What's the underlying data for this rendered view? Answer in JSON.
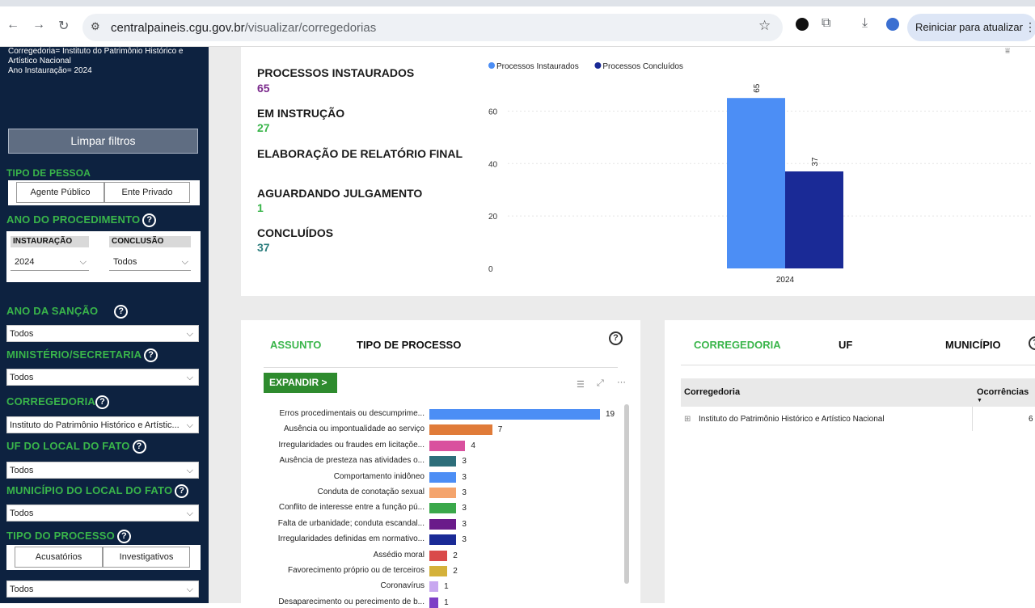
{
  "browser": {
    "url_host": "centralpaineis.cgu.gov.br",
    "url_path": "/visualizar/corregedorias",
    "update_label": "Reiniciar para atualizar"
  },
  "sidebar": {
    "filter_line1": "Corregedoria= Instituto do Patrimônio Histórico e",
    "filter_line2": "Artístico Nacional",
    "filter_line3": "Ano Instauração= 2024",
    "clear_label": "Limpar filtros",
    "tipo_pessoa_title": "TIPO DE PESSOA",
    "agente_publico": "Agente Público",
    "ente_privado": "Ente Privado",
    "ano_proc_title": "ANO DO PROCEDIMENTO",
    "instauracao_label": "INSTAURAÇÃO",
    "conclusao_label": "CONCLUSÃO",
    "instauracao_value": "2024",
    "conclusao_value": "Todos",
    "ano_sancao_title": "ANO DA SANÇÃO",
    "ano_sancao_value": "Todos",
    "ministerio_title": "MINISTÉRIO/SECRETARIA",
    "ministerio_value": "Todos",
    "corregedoria_title": "CORREGEDORIA",
    "corregedoria_value": "Instituto do Patrimônio Histórico e Artístic...",
    "uf_title": "UF DO LOCAL DO FATO",
    "uf_value": "Todos",
    "municipio_title": "MUNICÍPIO DO LOCAL DO FATO",
    "municipio_value": "Todos",
    "tipo_processo_title": "TIPO DO PROCESSO",
    "acusatorios": "Acusatórios",
    "investigativos": "Investigativos",
    "tipo_processo_value": "Todos",
    "help_glyph": "?"
  },
  "kpis": {
    "instaurados_label": "PROCESSOS INSTAURADOS",
    "instaurados_value": "65",
    "instrucao_label": "EM INSTRUÇÃO",
    "instrucao_value": "27",
    "relatorio_label": "ELABORAÇÃO DE RELATÓRIO FINAL",
    "julgamento_label": "AGUARDANDO JULGAMENTO",
    "julgamento_value": "1",
    "concluidos_label": "CONCLUÍDOS",
    "concluidos_value": "37"
  },
  "assunto_panel": {
    "tab_assunto": "ASSUNTO",
    "tab_tipo": "TIPO DE PROCESSO",
    "expandir_label": "EXPANDIR >"
  },
  "corregedoria_panel": {
    "tab_corregedoria": "CORREGEDORIA",
    "tab_uf": "UF",
    "tab_municipio": "MUNICÍPIO",
    "col_corregedoria": "Corregedoria",
    "col_ocorrencias": "Ocorrências",
    "row_name": "Instituto do Patrimônio Histórico e Artístico Nacional",
    "row_value": "6",
    "expand_glyph": "⊞"
  },
  "colors": {
    "green": "#39b54a",
    "purple": "#7b2a8c",
    "teal": "#2b7d7d",
    "light_blue": "#4c8ef5",
    "dark_blue": "#1a2a96"
  },
  "chart_data": [
    {
      "type": "bar",
      "categories": [
        "2024"
      ],
      "series": [
        {
          "name": "Processos Instaurados",
          "values": [
            65
          ],
          "color": "#4c8ef5"
        },
        {
          "name": "Processos Concluídos",
          "values": [
            37
          ],
          "color": "#1a2a96"
        }
      ],
      "yticks": [
        0,
        20,
        40,
        60
      ],
      "ylim": [
        0,
        70
      ],
      "legend": "top-left"
    },
    {
      "type": "bar",
      "orientation": "horizontal",
      "categories": [
        "Erros procedimentais ou descumprime...",
        "Ausência ou impontualidade ao serviço",
        "Irregularidades ou fraudes em licitaçõe...",
        "Ausência de presteza nas atividades o...",
        "Comportamento inidôneo",
        "Conduta de conotação sexual",
        "Conflito de interesse entre a função pú...",
        "Falta de urbanidade; conduta escandal...",
        "Irregularidades definidas em normativo...",
        "Assédio moral",
        "Favorecimento próprio ou de terceiros",
        "Coronavírus",
        "Desaparecimento ou perecimento de b..."
      ],
      "values": [
        19,
        7,
        4,
        3,
        3,
        3,
        3,
        3,
        3,
        2,
        2,
        1,
        1
      ],
      "colors": [
        "#4c8ef5",
        "#e07b39",
        "#d9519e",
        "#2d6e7a",
        "#4c8ef5",
        "#f4a46c",
        "#3aa84a",
        "#6a1b8a",
        "#1a2a96",
        "#d94a4a",
        "#d4b13a",
        "#c8a8f0",
        "#7d3fc6"
      ]
    }
  ]
}
